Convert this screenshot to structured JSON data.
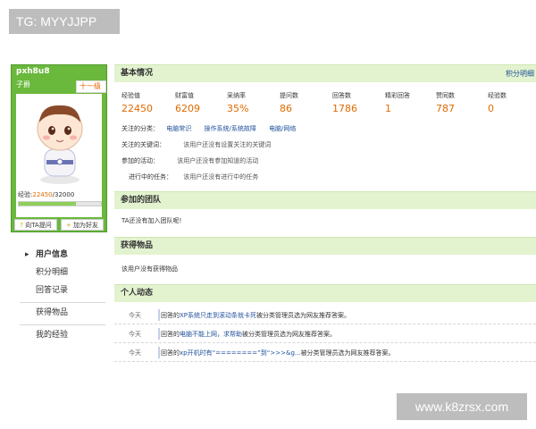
{
  "watermark_top": "TG: MYYJJPP",
  "watermark_bottom": "www.k8zrsx.com",
  "profile": {
    "username": "pxh8u8",
    "title": "子爵",
    "level": "十一级",
    "exp_label": "经验:",
    "exp_current": "22450",
    "exp_sep": "/",
    "exp_total": "32000",
    "exp_progress": 0.7,
    "ask_button": "向TA提问",
    "add_friend_button": "加为好友"
  },
  "nav": {
    "items": [
      "用户信息",
      "积分明细",
      "回答记录",
      "获得物品",
      "我的经验"
    ]
  },
  "basic": {
    "title": "基本情况",
    "right_link": "积分明细",
    "stats": [
      {
        "label": "经验值",
        "value": "22450"
      },
      {
        "label": "财富值",
        "value": "6209"
      },
      {
        "label": "采纳率",
        "value": "35%"
      },
      {
        "label": "提问数",
        "value": "86"
      },
      {
        "label": "回答数",
        "value": "1786"
      },
      {
        "label": "精彩回答",
        "value": "1"
      },
      {
        "label": "赞同数",
        "value": "787"
      },
      {
        "label": "经验数",
        "value": "0"
      }
    ],
    "categories_label": "关注的分类：",
    "categories": [
      "电脑常识",
      "操作系统/系统故障",
      "电脑/网络"
    ],
    "keywords_label": "关注的关键词：",
    "keywords_value": "该用户还没有设置关注的关键词",
    "activities_label": "参加的活动：",
    "activities_value": "该用户还没有参加知道的活动",
    "tasks_label": "进行中的任务：",
    "tasks_value": "该用户还没有进行中的任务"
  },
  "team": {
    "title": "参加的团队",
    "text": "TA还没有加入团队呢!"
  },
  "items": {
    "title": "获得物品",
    "text": "该用户没有获得物品"
  },
  "feed": {
    "title": "个人动态",
    "rows": [
      {
        "when": "今天",
        "prefix": "回答的",
        "link": "XP系统只走到滚动条就卡死",
        "suffix": "被分类管理员选为网友推荐答案。"
      },
      {
        "when": "今天",
        "prefix": "回答的",
        "link": "电脑不能上网，求帮助",
        "suffix": "被分类管理员选为网友推荐答案。"
      },
      {
        "when": "今天",
        "prefix": "回答的",
        "link": "xp开机时有“========”到“>>>&g...",
        "suffix": "被分类管理员选为网友推荐答案。"
      }
    ]
  }
}
